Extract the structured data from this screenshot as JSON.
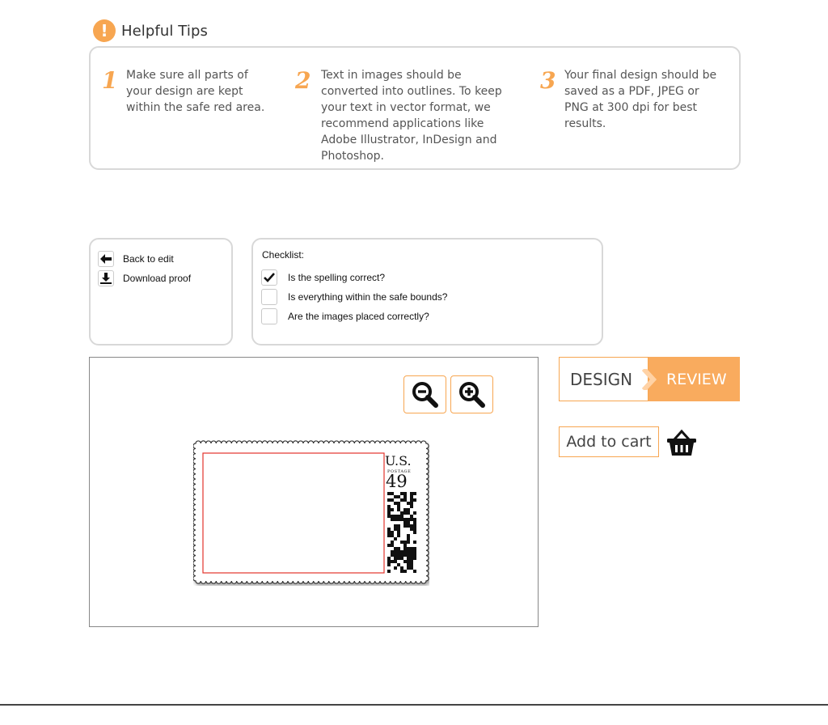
{
  "tips": {
    "title": "Helpful Tips",
    "icon": "!",
    "accent_color": "#f7a651",
    "items": [
      {
        "num": "1",
        "text": "Make sure all parts of your design are kept within the safe red area."
      },
      {
        "num": "2",
        "text": "Text in images should be converted into outlines. To keep your text in vector format, we recommend applications like Adobe Illustrator, InDesign and Photoshop."
      },
      {
        "num": "3",
        "text": "Your final design should be saved as a PDF, JPEG or PNG at 300 dpi for best results."
      }
    ]
  },
  "actions": [
    {
      "label": "Back to edit",
      "icon": "arrow-left-icon"
    },
    {
      "label": "Download proof",
      "icon": "download-icon"
    }
  ],
  "checklist": {
    "title": "Checklist:",
    "items": [
      {
        "label": "Is the spelling correct?",
        "checked": true
      },
      {
        "label": "Is everything within the safe bounds?",
        "checked": false
      },
      {
        "label": "Are the images placed correctly?",
        "checked": false
      }
    ]
  },
  "preview": {
    "zoom_out_icon": "zoom-out-icon",
    "zoom_in_icon": "zoom-in-icon",
    "stamp": {
      "country": "U.S.",
      "subtext": "POSTAGE",
      "value": "49",
      "safe_area_color": "#e2342c"
    }
  },
  "steps": {
    "design_label": "DESIGN",
    "review_label": "REVIEW",
    "active": "REVIEW"
  },
  "cart": {
    "label": "Add to cart",
    "icon": "basket-icon"
  }
}
